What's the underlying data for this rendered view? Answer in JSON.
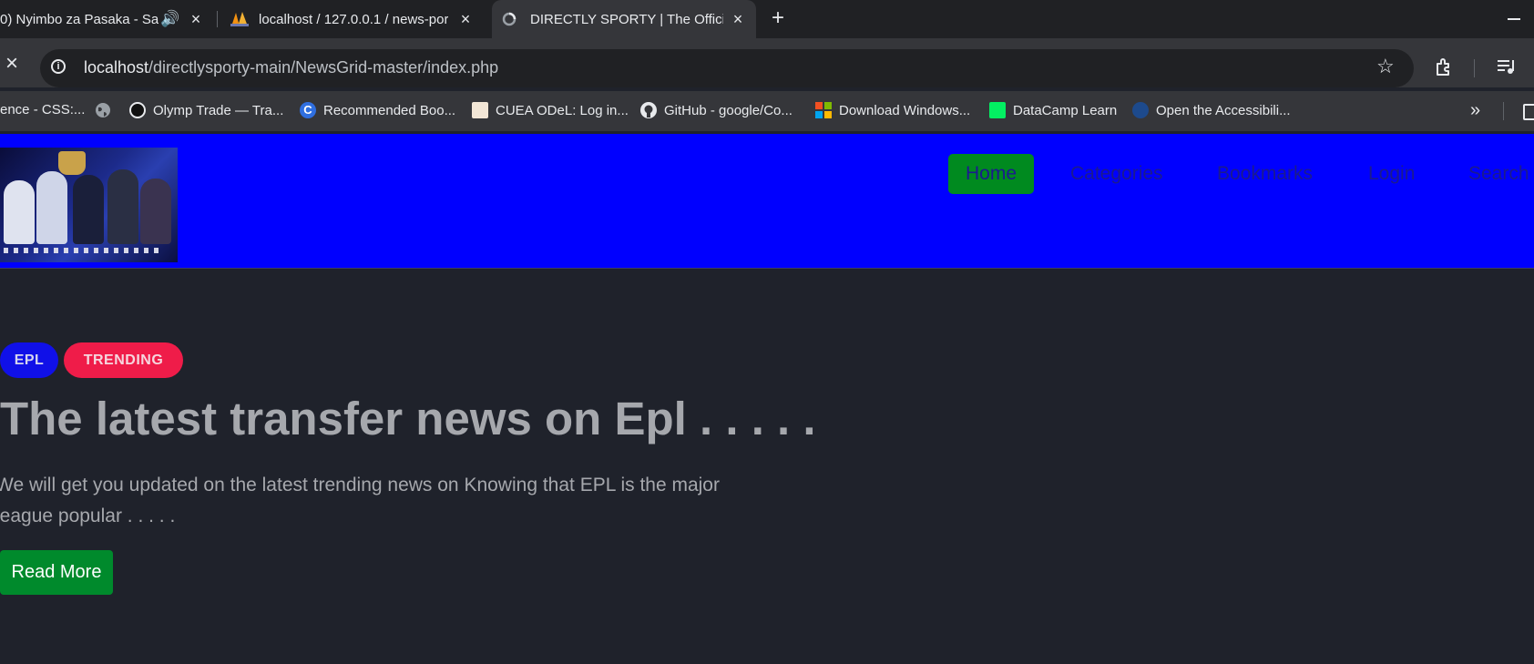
{
  "browser": {
    "tabs": [
      {
        "title": "0) Nyimbo za Pasaka - Sa",
        "favicon": "speaker-icon"
      },
      {
        "title": "localhost / 127.0.0.1 / news-por",
        "favicon": "phpmyadmin-icon"
      },
      {
        "title": "DIRECTLY SPORTY | The Official",
        "favicon": "loading-icon"
      }
    ],
    "address": {
      "host": "localhost",
      "path": "/directlysporty-main/NewsGrid-master/index.php"
    },
    "bookmarks": [
      {
        "label": "ence - CSS:...",
        "icon": null
      },
      {
        "label": "",
        "icon": "globe-icon"
      },
      {
        "label": "Olymp Trade — Tra...",
        "icon": "olymp-icon",
        "color": "#111111"
      },
      {
        "label": "Recommended Boo...",
        "icon": "c-icon",
        "color": "#2f6fe0"
      },
      {
        "label": "CUEA ODeL: Log in...",
        "icon": "cuea-icon",
        "color": "#f2e6d6"
      },
      {
        "label": "GitHub - google/Co...",
        "icon": "github-icon",
        "color": "#e8eaed"
      },
      {
        "label": "Download Windows...",
        "icon": "windows-icon"
      },
      {
        "label": "DataCamp Learn",
        "icon": "datacamp-icon",
        "color": "#03ef62"
      },
      {
        "label": "Open the Accessibili...",
        "icon": "accessibility-icon",
        "color": "#1d4a8c"
      }
    ]
  },
  "site": {
    "nav": [
      "Home",
      "Categories",
      "Bookmarks",
      "Login",
      "Search"
    ],
    "hero": {
      "badges": [
        "EPL",
        "TRENDING"
      ],
      "headline": "The latest transfer news on Epl . . . . .",
      "lede": "We will get you updated on the latest trending news on Knowing that EPL is the major league popular . . . . .",
      "cta": "Read More"
    }
  },
  "colors": {
    "header_bg": "#0000ff",
    "nav_active_bg": "#008a1f",
    "epl_badge": "#1010e8",
    "trending_badge": "#ef1c49",
    "page_bg": "#1f222b",
    "cta_bg": "#008a2c"
  }
}
